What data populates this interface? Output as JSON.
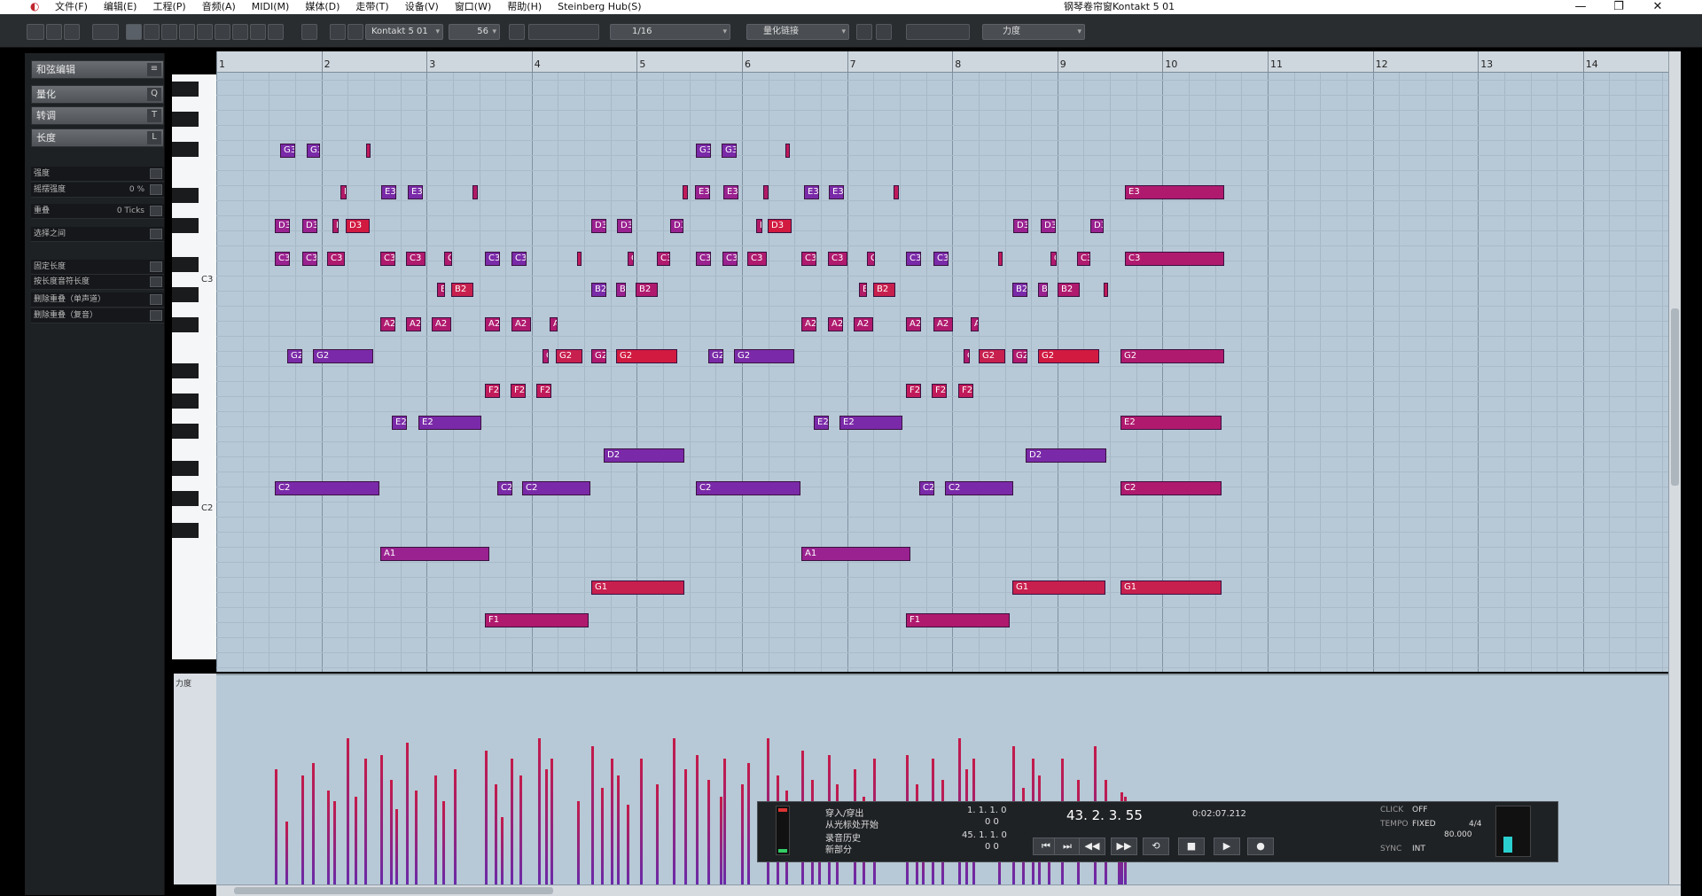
{
  "titlebar": {
    "menus": [
      "文件(F)",
      "编辑(E)",
      "工程(P)",
      "音频(A)",
      "MIDI(M)",
      "媒体(D)",
      "走带(T)",
      "设备(V)",
      "窗口(W)",
      "帮助(H)",
      "Steinberg Hub(S)"
    ],
    "window_title": "钢琴卷帘窗Kontakt 5 01",
    "minimize": "—",
    "restore": "❐",
    "close": "✕"
  },
  "toolbar": {
    "instrument": "Kontakt 5 01",
    "velocity": "56",
    "quantize": "1/16",
    "quantize_mode": "量化链接",
    "insert_velocity": "力度"
  },
  "leftpanel": {
    "sections": [
      "和弦编辑",
      "量化",
      "转调",
      "长度"
    ],
    "section_btns": [
      "≡",
      "Q",
      "T",
      "L"
    ],
    "rows": [
      {
        "label": "强度",
        "value": ""
      },
      {
        "label": "摇摆强度",
        "value": "0 %"
      },
      {
        "label": "重叠",
        "value": "0 Ticks"
      },
      {
        "label": "选择之间",
        "value": ""
      },
      {
        "label": "固定长度",
        "value": ""
      },
      {
        "label": "按长度音符长度",
        "value": ""
      },
      {
        "label": "删除重叠（单声道）",
        "value": ""
      },
      {
        "label": "删除重叠（复音）",
        "value": ""
      }
    ]
  },
  "keyboard": {
    "c3": "C3",
    "c2": "C2"
  },
  "ruler": {
    "bars": [
      "1",
      "2",
      "3",
      "4",
      "5",
      "6",
      "7",
      "8",
      "9",
      "10",
      "11",
      "12",
      "13",
      "14"
    ]
  },
  "velocity_label": "力度",
  "notes": [
    [
      "G3",
      303,
      65,
      14,
      "#7a2aa8"
    ],
    [
      "G3",
      327,
      65,
      12,
      "#7a2aa8"
    ],
    [
      "",
      382,
      65,
      4,
      "#c11a5a"
    ],
    [
      "G3",
      686,
      65,
      14,
      "#7a2aa8"
    ],
    [
      "G3",
      709,
      65,
      14,
      "#7a2aa8"
    ],
    [
      "",
      768,
      65,
      4,
      "#c11a5a"
    ],
    [
      "E",
      358,
      103,
      6,
      "#b11a66"
    ],
    [
      "E3",
      396,
      103,
      14,
      "#7a2aa8"
    ],
    [
      "E3",
      420,
      103,
      14,
      "#7a2aa8"
    ],
    [
      "E",
      480,
      103,
      5,
      "#b11a66"
    ],
    [
      "",
      673,
      103,
      5,
      "#c11a5a"
    ],
    [
      "E3",
      685,
      103,
      14,
      "#9a2290"
    ],
    [
      "E3",
      711,
      103,
      14,
      "#9a2290"
    ],
    [
      "E",
      748,
      103,
      5,
      "#b11a66"
    ],
    [
      "E3",
      785,
      103,
      14,
      "#7a2aa8"
    ],
    [
      "E3",
      808,
      103,
      14,
      "#7a2aa8"
    ],
    [
      "E",
      868,
      103,
      5,
      "#c11a5a"
    ],
    [
      "E3",
      1081,
      103,
      91,
      "#b01a6e"
    ],
    [
      "D3",
      298,
      134,
      14,
      "#9a2290"
    ],
    [
      "D3",
      323,
      134,
      14,
      "#9a2290"
    ],
    [
      "D",
      351,
      134,
      6,
      "#b11a66"
    ],
    [
      "D3",
      363,
      134,
      22,
      "#d21a40"
    ],
    [
      "D3",
      589,
      134,
      14,
      "#9a2290"
    ],
    [
      "D3",
      613,
      134,
      14,
      "#9a2290"
    ],
    [
      "D3",
      662,
      134,
      12,
      "#9a2290"
    ],
    [
      "D",
      741,
      134,
      6,
      "#b11a66"
    ],
    [
      "D3",
      752,
      134,
      22,
      "#d21a40"
    ],
    [
      "D3",
      978,
      134,
      14,
      "#9a2290"
    ],
    [
      "D3",
      1003,
      134,
      14,
      "#9a2290"
    ],
    [
      "D3",
      1049,
      134,
      12,
      "#9a2290"
    ],
    [
      "C3",
      298,
      164,
      14,
      "#9a2290"
    ],
    [
      "C3",
      323,
      164,
      14,
      "#9a2290"
    ],
    [
      "C3",
      346,
      164,
      16,
      "#b01a6e"
    ],
    [
      "C3",
      395,
      164,
      14,
      "#b01a6e"
    ],
    [
      "C3",
      419,
      164,
      18,
      "#b01a6e"
    ],
    [
      "C",
      454,
      164,
      7,
      "#b01a6e"
    ],
    [
      "C3",
      491,
      164,
      14,
      "#7a2aa8"
    ],
    [
      "C3",
      516,
      164,
      14,
      "#7a2aa8"
    ],
    [
      "",
      576,
      164,
      4,
      "#c11a5a"
    ],
    [
      "C",
      623,
      164,
      6,
      "#b01a6e"
    ],
    [
      "C3",
      650,
      164,
      12,
      "#b01a6e"
    ],
    [
      "C3",
      686,
      164,
      14,
      "#9a2290"
    ],
    [
      "C3",
      710,
      164,
      14,
      "#9a2290"
    ],
    [
      "C3",
      733,
      164,
      18,
      "#b01a6e"
    ],
    [
      "C3",
      783,
      164,
      14,
      "#b01a6e"
    ],
    [
      "C3",
      807,
      164,
      18,
      "#b01a6e"
    ],
    [
      "C",
      843,
      164,
      7,
      "#b01a6e"
    ],
    [
      "C3",
      879,
      164,
      14,
      "#7a2aa8"
    ],
    [
      "C3",
      904,
      164,
      14,
      "#7a2aa8"
    ],
    [
      "",
      964,
      164,
      4,
      "#c11a5a"
    ],
    [
      "C",
      1012,
      164,
      6,
      "#b01a6e"
    ],
    [
      "C3",
      1037,
      164,
      12,
      "#b01a6e"
    ],
    [
      "C3",
      1081,
      164,
      91,
      "#b01a6e"
    ],
    [
      "E",
      447,
      193,
      7,
      "#b11a66"
    ],
    [
      "B2",
      460,
      193,
      20,
      "#c8204e"
    ],
    [
      "B2",
      589,
      193,
      14,
      "#7a2aa8"
    ],
    [
      "B",
      612,
      193,
      9,
      "#9a2290"
    ],
    [
      "B2",
      630,
      193,
      20,
      "#b01a6e"
    ],
    [
      "E",
      836,
      193,
      7,
      "#b11a66"
    ],
    [
      "B2",
      849,
      193,
      20,
      "#c8204e"
    ],
    [
      "B2",
      977,
      193,
      14,
      "#7a2aa8"
    ],
    [
      "B",
      1001,
      193,
      9,
      "#9a2290"
    ],
    [
      "B2",
      1019,
      193,
      20,
      "#b01a6e"
    ],
    [
      "",
      1061,
      193,
      4,
      "#c11a5a"
    ],
    [
      "A2",
      395,
      224,
      14,
      "#b01a6e"
    ],
    [
      "A2",
      419,
      224,
      14,
      "#b01a6e"
    ],
    [
      "A2",
      442,
      224,
      18,
      "#b01a6e"
    ],
    [
      "A2",
      491,
      224,
      14,
      "#b01a6e"
    ],
    [
      "A2",
      516,
      224,
      18,
      "#b01a6e"
    ],
    [
      "A",
      551,
      224,
      7,
      "#b01a6e"
    ],
    [
      "A2",
      783,
      224,
      14,
      "#b01a6e"
    ],
    [
      "A2",
      807,
      224,
      14,
      "#b01a6e"
    ],
    [
      "A2",
      831,
      224,
      18,
      "#b01a6e"
    ],
    [
      "A2",
      879,
      224,
      14,
      "#b01a6e"
    ],
    [
      "A2",
      904,
      224,
      18,
      "#b01a6e"
    ],
    [
      "A",
      939,
      224,
      7,
      "#b01a6e"
    ],
    [
      "G2",
      309,
      254,
      14,
      "#7a2aa8"
    ],
    [
      "G2",
      333,
      254,
      55,
      "#7a2aa8"
    ],
    [
      "C",
      544,
      254,
      6,
      "#b01a6e"
    ],
    [
      "G2",
      557,
      254,
      24,
      "#c8204e"
    ],
    [
      "G2",
      589,
      254,
      14,
      "#b01a6e"
    ],
    [
      "G2",
      612,
      254,
      56,
      "#d21a40"
    ],
    [
      "G2",
      697,
      254,
      14,
      "#7a2aa8"
    ],
    [
      "G2",
      721,
      254,
      55,
      "#7a2aa8"
    ],
    [
      "C",
      932,
      254,
      6,
      "#b01a6e"
    ],
    [
      "G2",
      946,
      254,
      24,
      "#c8204e"
    ],
    [
      "G2",
      977,
      254,
      14,
      "#b01a6e"
    ],
    [
      "G2",
      1001,
      254,
      56,
      "#d21a40"
    ],
    [
      "G2",
      1077,
      254,
      95,
      "#b01a6e"
    ],
    [
      "F2",
      491,
      285,
      14,
      "#c11a5a"
    ],
    [
      "F2",
      515,
      285,
      14,
      "#c11a5a"
    ],
    [
      "F2",
      539,
      285,
      14,
      "#c11a5a"
    ],
    [
      "F2",
      879,
      285,
      14,
      "#c11a5a"
    ],
    [
      "F2",
      903,
      285,
      14,
      "#c11a5a"
    ],
    [
      "F2",
      927,
      285,
      14,
      "#c11a5a"
    ],
    [
      "E2",
      406,
      315,
      14,
      "#7a2aa8"
    ],
    [
      "E2",
      430,
      315,
      58,
      "#7a2aa8"
    ],
    [
      "E2",
      794,
      315,
      14,
      "#7a2aa8"
    ],
    [
      "E2",
      818,
      315,
      58,
      "#7a2aa8"
    ],
    [
      "E2",
      1077,
      315,
      93,
      "#b01a6e"
    ],
    [
      "D2",
      601,
      345,
      74,
      "#7a2aa8"
    ],
    [
      "D2",
      989,
      345,
      74,
      "#7a2aa8"
    ],
    [
      "C2",
      298,
      375,
      96,
      "#7a2aa8"
    ],
    [
      "C2",
      503,
      375,
      14,
      "#7a2aa8"
    ],
    [
      "C2",
      526,
      375,
      63,
      "#7a2aa8"
    ],
    [
      "C2",
      686,
      375,
      96,
      "#7a2aa8"
    ],
    [
      "C2",
      891,
      375,
      14,
      "#7a2aa8"
    ],
    [
      "C2",
      915,
      375,
      63,
      "#7a2aa8"
    ],
    [
      "C2",
      1077,
      375,
      93,
      "#b01a6e"
    ],
    [
      "A1",
      395,
      435,
      100,
      "#9a2290"
    ],
    [
      "A1",
      783,
      435,
      100,
      "#9a2290"
    ],
    [
      "G1",
      589,
      466,
      85,
      "#c8204e"
    ],
    [
      "G1",
      977,
      466,
      85,
      "#c8204e"
    ],
    [
      "G1",
      1077,
      466,
      93,
      "#c8204e"
    ],
    [
      "F1",
      491,
      496,
      95,
      "#b01a6e"
    ],
    [
      "F1",
      879,
      496,
      95,
      "#b01a6e"
    ]
  ],
  "velocity_bars": [
    [
      298,
      0.55
    ],
    [
      308,
      0.3
    ],
    [
      322,
      0.52
    ],
    [
      332,
      0.58
    ],
    [
      346,
      0.45
    ],
    [
      352,
      0.4
    ],
    [
      364,
      0.7
    ],
    [
      371,
      0.42
    ],
    [
      380,
      0.6
    ],
    [
      395,
      0.62
    ],
    [
      404,
      0.5
    ],
    [
      409,
      0.36
    ],
    [
      419,
      0.68
    ],
    [
      427,
      0.45
    ],
    [
      445,
      0.52
    ],
    [
      452,
      0.4
    ],
    [
      463,
      0.55
    ],
    [
      491,
      0.64
    ],
    [
      500,
      0.48
    ],
    [
      506,
      0.32
    ],
    [
      515,
      0.6
    ],
    [
      523,
      0.52
    ],
    [
      540,
      0.7
    ],
    [
      547,
      0.55
    ],
    [
      552,
      0.6
    ],
    [
      576,
      0.4
    ],
    [
      589,
      0.66
    ],
    [
      598,
      0.46
    ],
    [
      607,
      0.6
    ],
    [
      613,
      0.52
    ],
    [
      622,
      0.38
    ],
    [
      634,
      0.6
    ],
    [
      649,
      0.48
    ],
    [
      664,
      0.7
    ],
    [
      675,
      0.55
    ],
    [
      686,
      0.62
    ],
    [
      696,
      0.5
    ],
    [
      708,
      0.42
    ],
    [
      711,
      0.6
    ],
    [
      727,
      0.48
    ],
    [
      733,
      0.58
    ],
    [
      751,
      0.7
    ],
    [
      760,
      0.52
    ],
    [
      768,
      0.45
    ],
    [
      783,
      0.64
    ],
    [
      792,
      0.5
    ],
    [
      798,
      0.36
    ],
    [
      807,
      0.62
    ],
    [
      815,
      0.48
    ],
    [
      831,
      0.55
    ],
    [
      839,
      0.42
    ],
    [
      849,
      0.6
    ],
    [
      879,
      0.62
    ],
    [
      888,
      0.48
    ],
    [
      894,
      0.32
    ],
    [
      903,
      0.6
    ],
    [
      912,
      0.5
    ],
    [
      927,
      0.7
    ],
    [
      934,
      0.55
    ],
    [
      940,
      0.6
    ],
    [
      964,
      0.4
    ],
    [
      977,
      0.66
    ],
    [
      986,
      0.46
    ],
    [
      995,
      0.6
    ],
    [
      1001,
      0.52
    ],
    [
      1010,
      0.38
    ],
    [
      1022,
      0.6
    ],
    [
      1037,
      0.5
    ],
    [
      1052,
      0.66
    ],
    [
      1062,
      0.5
    ],
    [
      1074,
      0.4
    ],
    [
      1077,
      0.44
    ],
    [
      1080,
      0.42
    ]
  ],
  "transport": {
    "punch_in": "穿入/穿出",
    "from_start": "从光标处开始",
    "rec_mode": "录音历史",
    "new_part": "新部分",
    "left_loc": "1. 1. 1. 0",
    "left_offset": "0  0",
    "right_loc": "45. 1. 1. 0",
    "right_offset": "0  0",
    "position": "43.  2.  3.  55",
    "time": "0:02:07.212",
    "click_label": "CLICK",
    "click_value": "OFF",
    "tempo_label": "TEMPO",
    "tempo_mode": "FIXED",
    "signature": "4/4",
    "tempo": "80.000",
    "sync_label": "SYNC",
    "sync_value": "INT",
    "buttons": [
      "⏮",
      "⏭",
      "◀◀",
      "▶▶",
      "⟲",
      "■",
      "▶",
      "●"
    ]
  }
}
